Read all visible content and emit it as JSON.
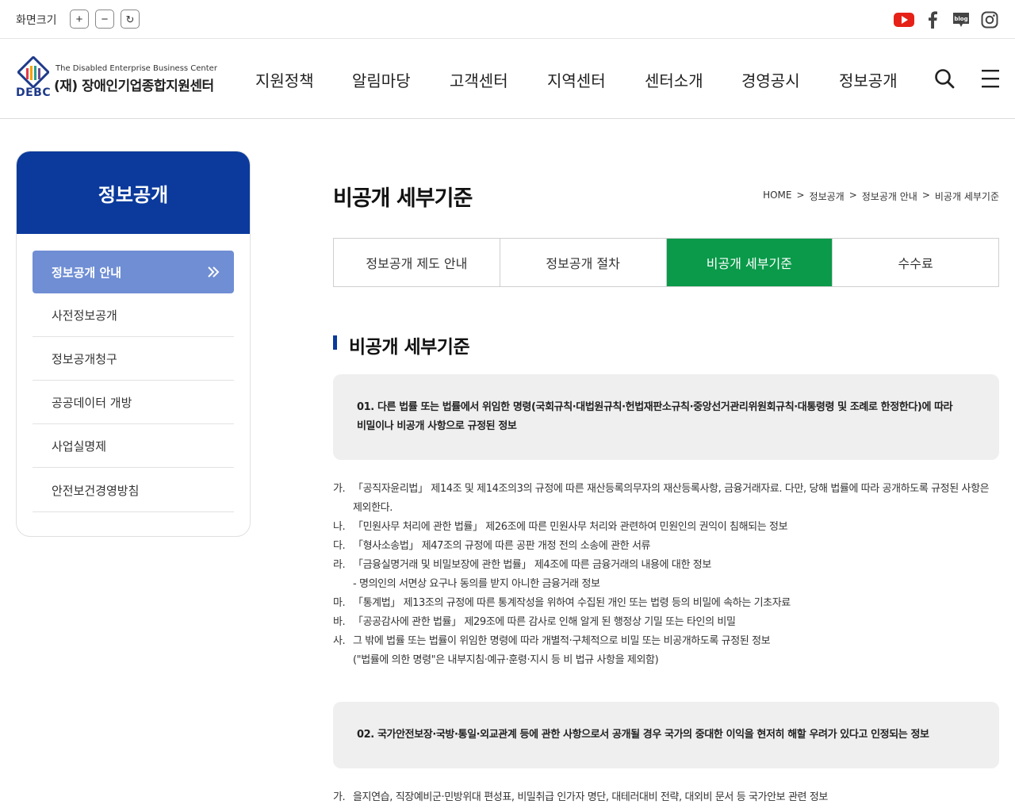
{
  "topbar": {
    "zoom_label": "화면크기",
    "zoom_in": "+",
    "zoom_out": "−",
    "zoom_reset": "↻",
    "social": {
      "youtube_color": "#e62117",
      "blog_text": "blog"
    }
  },
  "logo": {
    "english": "The Disabled Enterprise Business Center",
    "korean": "(재) 장애인기업종합지원센터",
    "short": "DEBC"
  },
  "nav": {
    "items": [
      "지원정책",
      "알림마당",
      "고객센터",
      "지역센터",
      "센터소개",
      "경영공시",
      "정보공개"
    ]
  },
  "sidebar": {
    "title": "정보공개",
    "active": "정보공개 안내",
    "items": [
      "사전정보공개",
      "정보공개청구",
      "공공데이터 개방",
      "사업실명제",
      "안전보건경영방침"
    ]
  },
  "page": {
    "title": "비공개 세부기준",
    "breadcrumb": [
      "HOME",
      ">",
      "정보공개",
      ">",
      "정보공개 안내",
      ">",
      "비공개 세부기준"
    ]
  },
  "tabs": [
    {
      "label": "정보공개 제도 안내",
      "active": false
    },
    {
      "label": "정보공개 절차",
      "active": false
    },
    {
      "label": "비공개 세부기준",
      "active": true
    },
    {
      "label": "수수료",
      "active": false
    }
  ],
  "section": {
    "title": "비공개 세부기준",
    "notice1": {
      "line1": "01. 다른 법률 또는 법률에서 위임한 명령(국회규칙·대법원규칙·헌법재판소규칙·중앙선거관리위원회규칙·대통령령 및 조례로 한정한다)에 따라",
      "line2": "비밀이나 비공개 사항으로 규정된 정보"
    },
    "list1": [
      {
        "marker": "가.",
        "line1": "「공직자윤리법」 제14조 및 제14조의3의 규정에 따른 재산등록의무자의 재산등록사항, 금융거래자료. 다만, 당해 법률에 따라 공개하도록 규정된 사항은",
        "line2": "제외한다."
      },
      {
        "marker": "나.",
        "line1": "「민원사무 처리에 관한 법률」 제26조에 따른 민원사무 처리와 관련하여 민원인의 권익이 침해되는 정보",
        "line2": ""
      },
      {
        "marker": "다.",
        "line1": "「형사소송법」 제47조의 규정에 따른 공판 개정 전의 소송에 관한 서류",
        "line2": ""
      },
      {
        "marker": "라.",
        "line1": "「금융실명거래 및 비밀보장에 관한 법률」 제4조에 따른 금융거래의 내용에 대한 정보",
        "line2": "- 명의인의 서면상 요구나 동의를 받지 아니한 금융거래 정보"
      },
      {
        "marker": "마.",
        "line1": "「통계법」 제13조의 규정에 따른 통계작성을 위하여 수집된 개인 또는 법령 등의 비밀에 속하는 기초자료",
        "line2": ""
      },
      {
        "marker": "바.",
        "line1": "「공공감사에 관한 법률」 제29조에 따른 감사로 인해 알게 된 행정상 기밀 또는 타인의 비밀",
        "line2": ""
      },
      {
        "marker": "사.",
        "line1": "그 밖에 법률 또는 법률이 위임한 명령에 따라 개별적·구체적으로 비밀 또는 비공개하도록 규정된 정보",
        "line2": "(\"법률에 의한 명령\"은 내부지침·예규·훈령·지시 등 비 법규 사항을 제외함)"
      }
    ],
    "notice2": {
      "line1": "02. 국가안전보장·국방·통일·외교관계 등에 관한 사항으로서 공개될 경우 국가의 중대한 이익을 현저히 해할 우려가 있다고 인정되는 정보"
    },
    "list2": [
      {
        "marker": "가.",
        "line1": "을지연습, 직장예비군·민방위대 편성표, 비밀취급 인가자 명단, 대테러대비 전략, 대외비 문서 등 국가안보 관련 정보",
        "line2": ""
      }
    ]
  }
}
